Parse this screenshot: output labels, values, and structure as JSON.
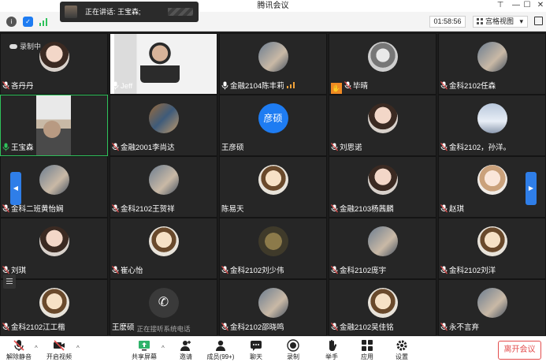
{
  "window": {
    "title": "腾讯会议"
  },
  "toast": {
    "label": "正在讲话: 王宝森;"
  },
  "toolbar": {
    "timer": "01:58:56",
    "view_mode": "宫格视图"
  },
  "recording": {
    "label": "录制中"
  },
  "colors": {
    "accent": "#1e7cf2",
    "active_border": "#2fc25b",
    "leave": "#e34d4d",
    "hand": "#f08a24"
  },
  "tiles": [
    {
      "name": "吝丹丹",
      "mic": "muted",
      "avatar": "girl-icon"
    },
    {
      "name": "Jeff",
      "mic": "on",
      "avatar": "video"
    },
    {
      "name": "金融2104陈丰莉",
      "mic": "on",
      "avatar": "photo-icon",
      "level": true
    },
    {
      "name": "毕晴",
      "mic": "muted",
      "avatar": "dancer-icon",
      "hand": true
    },
    {
      "name": "金科2102任森",
      "mic": "muted",
      "avatar": "photo-icon"
    },
    {
      "name": "王宝森",
      "mic": "speaking",
      "avatar": "video",
      "active": true
    },
    {
      "name": "金融2001李尚达",
      "mic": "muted",
      "avatar": "dragon-icon"
    },
    {
      "name": "王彦硕",
      "mic": "none",
      "avatar": "initial",
      "initial": "彦硕"
    },
    {
      "name": "刘思诺",
      "mic": "muted",
      "avatar": "girl-icon"
    },
    {
      "name": "金科2102，孙洋。",
      "mic": "muted",
      "avatar": "sky-icon"
    },
    {
      "name": "金科二班黄怡娴",
      "mic": "muted",
      "avatar": "photo-icon"
    },
    {
      "name": "金科2102王贺祥",
      "mic": "muted",
      "avatar": "photo-icon"
    },
    {
      "name": "陈易天",
      "mic": "none",
      "avatar": "cartoon-icon"
    },
    {
      "name": "金融2103杨茜麟",
      "mic": "muted",
      "avatar": "girl-icon"
    },
    {
      "name": "赵琪",
      "mic": "muted",
      "avatar": "doll-icon"
    },
    {
      "name": "刘琪",
      "mic": "muted",
      "avatar": "girl-icon"
    },
    {
      "name": "崔心怡",
      "mic": "muted",
      "avatar": "cartoon-icon"
    },
    {
      "name": "金科2102刘少伟",
      "mic": "muted",
      "avatar": "dog-icon"
    },
    {
      "name": "金科2102庞宇",
      "mic": "muted",
      "avatar": "photo-icon"
    },
    {
      "name": "金科2102刘洋",
      "mic": "muted",
      "avatar": "cartoon-icon"
    },
    {
      "name": "金科2102江工楷",
      "mic": "muted",
      "avatar": "cartoon-icon"
    },
    {
      "name": "王麽硕",
      "mic": "none",
      "avatar": "phone-icon",
      "caption": "正在接听系统电话"
    },
    {
      "name": "金科2102邵晓鸣",
      "mic": "muted",
      "avatar": "photo-icon"
    },
    {
      "name": "金融2102吴佳铭",
      "mic": "muted",
      "avatar": "cartoon-icon"
    },
    {
      "name": "永不言弃",
      "mic": "muted",
      "avatar": "photo-icon"
    }
  ],
  "bottom": {
    "unmute": "解除静音",
    "video": "开启视频",
    "share": "共享屏幕",
    "invite": "邀请",
    "members": "成员(99+)",
    "chat": "聊天",
    "record": "录制",
    "raise": "举手",
    "apps": "应用",
    "settings": "设置",
    "leave": "离开会议"
  }
}
